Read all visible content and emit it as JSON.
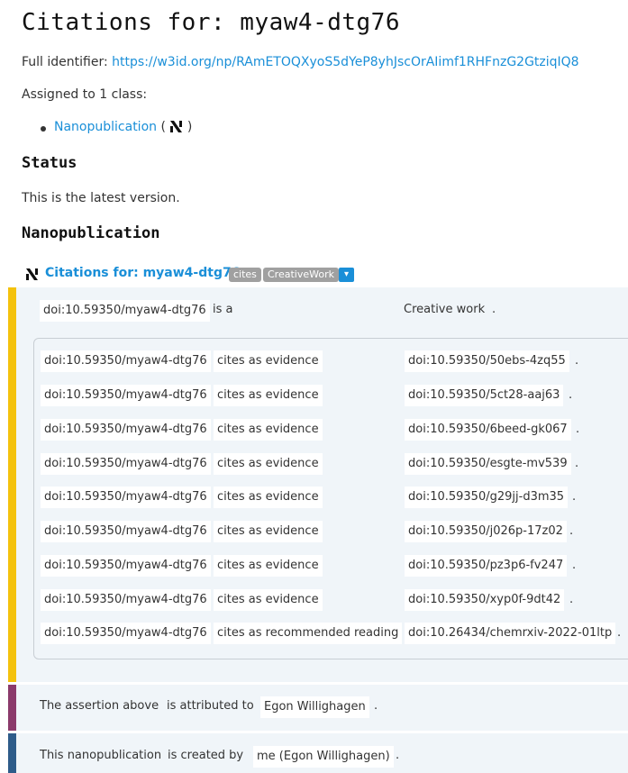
{
  "page": {
    "title": "Citations for: myaw4-dtg76",
    "full_identifier_label": "Full identifier:",
    "full_identifier_url": "https://w3id.org/np/RAmETOQXyoS5dYeP8yhJscOrAIimf1RHFnzG2GtziqIQ8",
    "assigned_text": "Assigned to 1 class:",
    "class_link": "Nanopublication",
    "class_paren_open": "(",
    "class_paren_close": ")",
    "status_heading": "Status",
    "status_text": "This is the latest version.",
    "nanopub_heading": "Nanopublication"
  },
  "nanopub": {
    "title": "Citations for: myaw4-dtg76",
    "badges": [
      "cites",
      "CreativeWork"
    ],
    "dropdown_glyph": "▾",
    "type_statement": {
      "subject": "doi:10.59350/myaw4-dtg76",
      "predicate": "is a",
      "object": "Creative work",
      "dot": "."
    },
    "citations": [
      {
        "subject": "doi:10.59350/myaw4-dtg76",
        "predicate": "cites as evidence",
        "object": "doi:10.59350/50ebs-4zq55",
        "dot": "."
      },
      {
        "subject": "doi:10.59350/myaw4-dtg76",
        "predicate": "cites as evidence",
        "object": "doi:10.59350/5ct28-aaj63",
        "dot": "."
      },
      {
        "subject": "doi:10.59350/myaw4-dtg76",
        "predicate": "cites as evidence",
        "object": "doi:10.59350/6beed-gk067",
        "dot": "."
      },
      {
        "subject": "doi:10.59350/myaw4-dtg76",
        "predicate": "cites as evidence",
        "object": "doi:10.59350/esgte-mv539",
        "dot": "."
      },
      {
        "subject": "doi:10.59350/myaw4-dtg76",
        "predicate": "cites as evidence",
        "object": "doi:10.59350/g29jj-d3m35",
        "dot": "."
      },
      {
        "subject": "doi:10.59350/myaw4-dtg76",
        "predicate": "cites as evidence",
        "object": "doi:10.59350/j026p-17z02",
        "dot": "."
      },
      {
        "subject": "doi:10.59350/myaw4-dtg76",
        "predicate": "cites as evidence",
        "object": "doi:10.59350/pz3p6-fv247",
        "dot": "."
      },
      {
        "subject": "doi:10.59350/myaw4-dtg76",
        "predicate": "cites as evidence",
        "object": "doi:10.59350/xyp0f-9dt42",
        "dot": "."
      },
      {
        "subject": "doi:10.59350/myaw4-dtg76",
        "predicate": "cites as recommended reading",
        "object": "doi:10.26434/chemrxiv-2022-01ltp",
        "dot": "."
      }
    ],
    "provenance": {
      "subject": "The assertion above",
      "predicate": "is attributed to",
      "object": "Egon Willighagen",
      "dot": "."
    },
    "pubinfo": {
      "subject": "This nanopublication",
      "predicate": "is created by",
      "object": "me (Egon Willighagen)",
      "dot": "."
    }
  },
  "colors": {
    "link": "#1a8fd8",
    "assertion_bar": "#f4c20d",
    "provenance_bar": "#8b3a6b",
    "pubinfo_bar": "#2e5c8a",
    "band_background": "#f0f5f9",
    "badge": "#a0a0a0"
  },
  "icons": {
    "nanopub_logo": "nanopub-logo-icon",
    "dropdown": "chevron-down-icon"
  }
}
